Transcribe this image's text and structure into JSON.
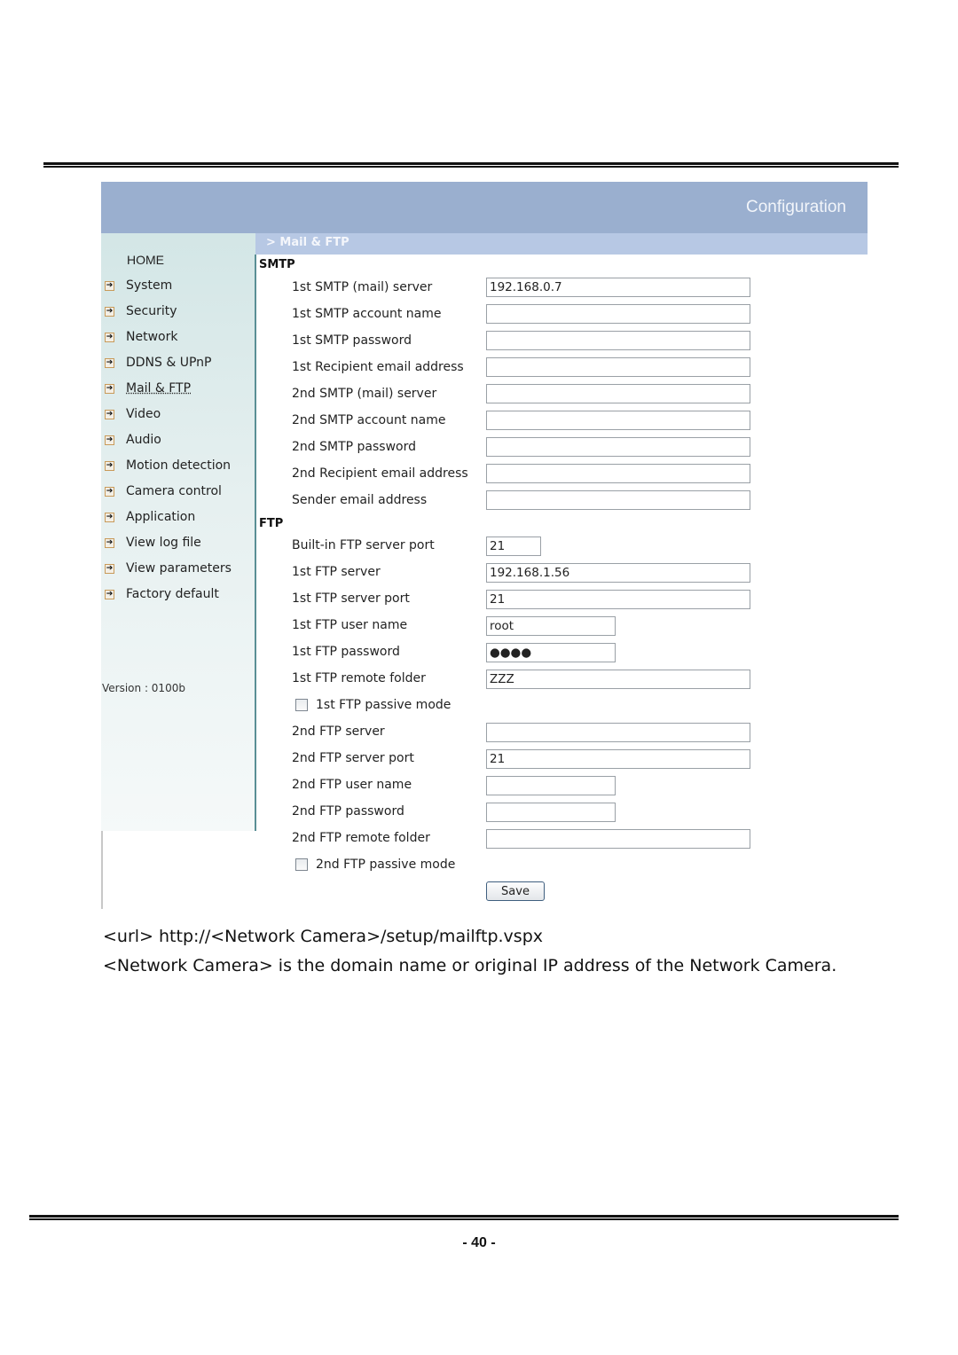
{
  "header": {
    "title": "Configuration",
    "breadcrumb": "> Mail & FTP"
  },
  "sidebar": {
    "home": "HOME",
    "items": [
      {
        "label": "System"
      },
      {
        "label": "Security"
      },
      {
        "label": "Network"
      },
      {
        "label": "DDNS & UPnP"
      },
      {
        "label": "Mail & FTP",
        "active": true
      },
      {
        "label": "Video"
      },
      {
        "label": "Audio"
      },
      {
        "label": "Motion detection"
      },
      {
        "label": "Camera control"
      },
      {
        "label": "Application"
      },
      {
        "label": "View log file"
      },
      {
        "label": "View parameters"
      },
      {
        "label": "Factory default"
      }
    ],
    "item_icon": "arrow-right-icon",
    "version": "Version : 0100b"
  },
  "smtp": {
    "title": "SMTP",
    "fields": [
      {
        "label": "1st SMTP (mail) server",
        "value": "192.168.0.7"
      },
      {
        "label": "1st SMTP account name",
        "value": ""
      },
      {
        "label": "1st SMTP password",
        "value": ""
      },
      {
        "label": "1st Recipient email address",
        "value": ""
      },
      {
        "label": "2nd SMTP (mail) server",
        "value": ""
      },
      {
        "label": "2nd SMTP account name",
        "value": ""
      },
      {
        "label": "2nd SMTP password",
        "value": ""
      },
      {
        "label": "2nd Recipient email address",
        "value": ""
      },
      {
        "label": "Sender email address",
        "value": ""
      }
    ]
  },
  "ftp": {
    "title": "FTP",
    "fields": [
      {
        "label": "Built-in FTP server port",
        "value": "21"
      },
      {
        "label": "1st FTP server",
        "value": "192.168.1.56"
      },
      {
        "label": "1st FTP server port",
        "value": "21"
      },
      {
        "label": "1st FTP user name",
        "value": "root"
      },
      {
        "label": "1st FTP password",
        "value": "●●●●"
      },
      {
        "label": "1st FTP remote folder",
        "value": "ZZZ"
      },
      {
        "label": "1st FTP passive mode",
        "checked": false
      },
      {
        "label": "2nd FTP server",
        "value": ""
      },
      {
        "label": "2nd FTP server port",
        "value": "21"
      },
      {
        "label": "2nd FTP user name",
        "value": ""
      },
      {
        "label": "2nd FTP password",
        "value": ""
      },
      {
        "label": "2nd FTP remote folder",
        "value": ""
      },
      {
        "label": "2nd FTP passive mode",
        "checked": false
      }
    ],
    "save_label": "Save"
  },
  "document": {
    "url_line": "<url> http://<Network Camera>/setup/mailftp.vspx",
    "description": "<Network Camera> is the domain name or original IP address of the Network Camera.",
    "page_number": "- 40 -"
  },
  "colors": {
    "banner": "#9aafcf",
    "subbar": "#b7c8e4",
    "sidebar": "#d3e6e6",
    "sidebar_border": "#5a8f95"
  }
}
